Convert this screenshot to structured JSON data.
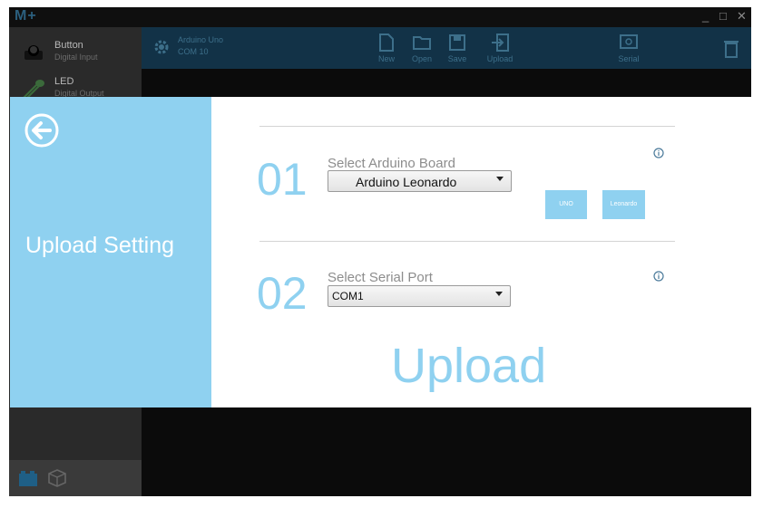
{
  "app": {
    "logo": "M+",
    "window_controls": [
      "_",
      "□",
      "✕"
    ]
  },
  "sidebar": {
    "items": [
      {
        "name": "Button",
        "sub": "Digital Input",
        "icon": "button-component-icon"
      },
      {
        "name": "LED",
        "sub": "Digital Output",
        "icon": "led-component-icon"
      }
    ]
  },
  "toolbar": {
    "board": "Arduino Uno",
    "port": "COM 10",
    "buttons": {
      "new": "New",
      "open": "Open",
      "save": "Save",
      "upload": "Upload",
      "serial": "Serial"
    }
  },
  "upload_setting": {
    "title": "Upload Setting",
    "steps": [
      {
        "num": "01",
        "label": "Select Arduino Board",
        "value": "Arduino Leonardo",
        "options": [
          "UNO",
          "Leonardo"
        ]
      },
      {
        "num": "02",
        "label": "Select Serial Port",
        "value": "COM1"
      }
    ],
    "upload_label": "Upload"
  },
  "colors": {
    "accent": "#8fd1f0",
    "toolbar": "#123247",
    "sidebar": "#2a2a2a",
    "text_muted": "#8d8d8d"
  }
}
